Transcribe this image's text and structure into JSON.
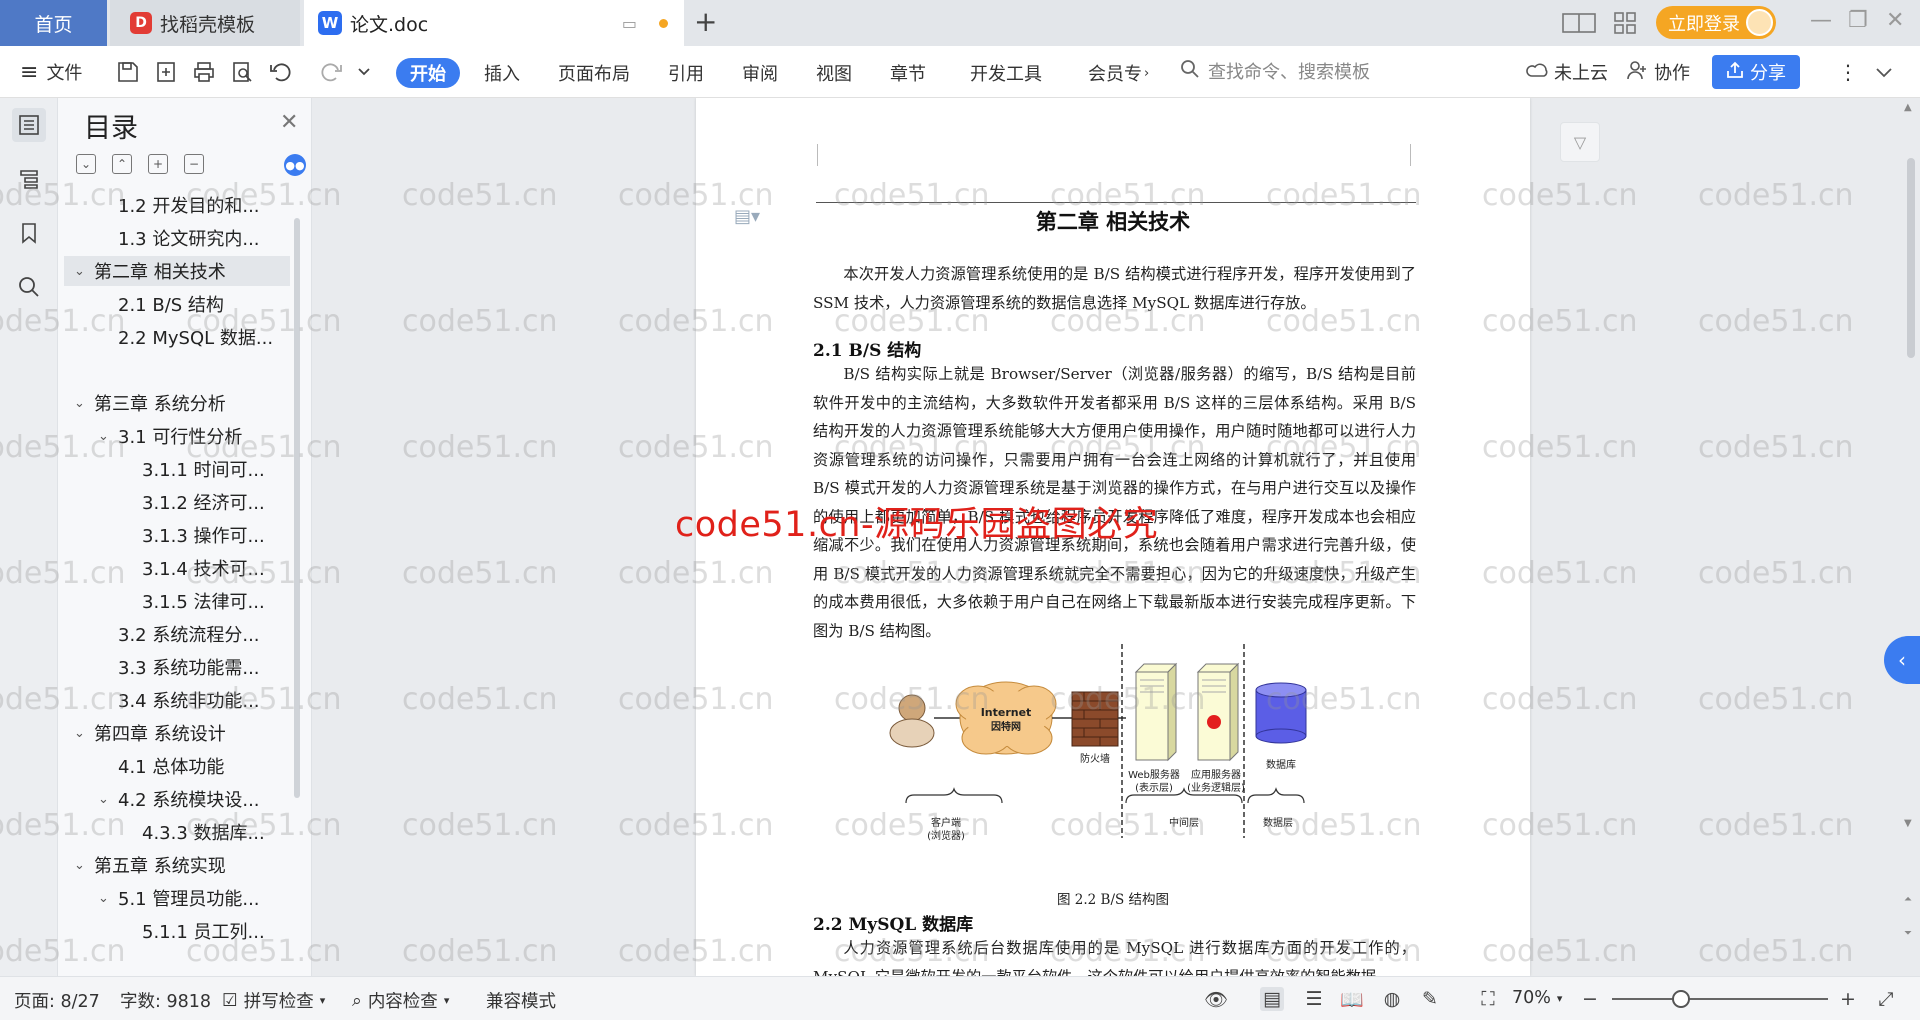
{
  "tabs": {
    "home": "首页",
    "template": "找稻壳模板",
    "document": "论文.doc",
    "new_tab": "+"
  },
  "titlebar": {
    "login": "立即登录"
  },
  "ribbon": {
    "file": "文件",
    "menus": [
      "开始",
      "插入",
      "页面布局",
      "引用",
      "审阅",
      "视图",
      "章节",
      "开发工具",
      "会员专"
    ],
    "search_placeholder": "查找命令、搜索模板",
    "cloud": "未上云",
    "collab": "协作",
    "share": "分享"
  },
  "toc": {
    "title": "目录",
    "items": [
      {
        "label": "1.2 开发目的和...",
        "level": 2
      },
      {
        "label": "1.3 论文研究内...",
        "level": 2
      },
      {
        "label": "第二章 相关技术",
        "level": 1,
        "expanded": true,
        "selected": true
      },
      {
        "label": "2.1 B/S 结构",
        "level": 2
      },
      {
        "label": "2.2 MySQL 数据...",
        "level": 2
      },
      {
        "label": "第三章 系统分析",
        "level": 1,
        "expanded": true
      },
      {
        "label": "3.1 可行性分析",
        "level": 2,
        "expanded": true
      },
      {
        "label": "3.1.1 时间可...",
        "level": 3
      },
      {
        "label": "3.1.2 经济可...",
        "level": 3
      },
      {
        "label": "3.1.3 操作可...",
        "level": 3
      },
      {
        "label": "3.1.4 技术可...",
        "level": 3
      },
      {
        "label": "3.1.5 法律可...",
        "level": 3
      },
      {
        "label": "3.2 系统流程分...",
        "level": 2
      },
      {
        "label": "3.3 系统功能需...",
        "level": 2
      },
      {
        "label": "3.4 系统非功能...",
        "level": 2
      },
      {
        "label": "第四章 系统设计",
        "level": 1,
        "expanded": true
      },
      {
        "label": "4.1 总体功能",
        "level": 2
      },
      {
        "label": "4.2 系统模块设...",
        "level": 2,
        "expanded": true
      },
      {
        "label": "4.3.3 数据库...",
        "level": 3
      },
      {
        "label": "第五章 系统实现",
        "level": 1,
        "expanded": true
      },
      {
        "label": "5.1 管理员功能...",
        "level": 2,
        "expanded": true
      },
      {
        "label": "5.1.1 员工列...",
        "level": 3
      }
    ]
  },
  "document": {
    "chapter_title": "第二章 相关技术",
    "intro": "本次开发人力资源管理系统使用的是 B/S 结构模式进行程序开发，程序开发使用到了 SSM 技术，人力资源管理系统的数据信息选择 MySQL 数据库进行存放。",
    "section1_title": "2.1 B/S 结构",
    "section1_body": "B/S 结构实际上就是 Browser/Server（浏览器/服务器）的缩写，B/S 结构是目前软件开发中的主流结构，大多数软件开发者都采用 B/S 这样的三层体系结构。采用 B/S 结构开发的人力资源管理系统能够大大方便用户使用操作，用户随时随地都可以进行人力资源管理系统的访问操作，只需要用户拥有一台会连上网络的计算机就行了，并且使用 B/S 模式开发的人力资源管理系统是基于浏览器的操作方式，在与用户进行交互以及操作的使用上都更加简单，B/S 模式也给程序员开发程序降低了难度，程序开发成本也会相应缩减不少。我们在使用人力资源管理系统期间，系统也会随着用户需求进行完善升级，使用 B/S 模式开发的人力资源管理系统就完全不需要担心，因为它的升级速度快，升级产生的成本费用很低，大多依赖于用户自己在网络上下载最新版本进行安装完成程序更新。下图为 B/S 结构图。",
    "figure_caption": "图 2.2 B/S 结构图",
    "section2_title": "2.2 MySQL 数据库",
    "section2_body": "人力资源管理系统后台数据库使用的是 MySQL 进行数据库方面的开发工作的，MySQL 它是微软开发的一款平台软件，这个软件可以给用户提供高效率的智能数据"
  },
  "diagram": {
    "internet": "Internet",
    "internet_cn": "因特网",
    "firewall": "防火墙",
    "web_server": "Web服务器",
    "web_server_sub": "(表示层)",
    "app_server": "应用服务器",
    "app_server_sub": "(业务逻辑层)",
    "database": "数据库",
    "client": "客户端",
    "client_sub": "(浏览器)",
    "middle_tier": "中间层",
    "data_tier": "数据层"
  },
  "watermark": {
    "text": "code51.cn",
    "stamp": "code51.cn-源码乐园盗图必究"
  },
  "status": {
    "page": "页面: 8/27",
    "words": "字数: 9818",
    "spellcheck": "拼写检查",
    "content_check": "内容检查",
    "compat": "兼容模式",
    "zoom": "70%"
  },
  "colors": {
    "accent": "#3b7cf0",
    "home_tab": "#4f79c6",
    "login": "#f5a623",
    "stamp": "#e0211a"
  }
}
